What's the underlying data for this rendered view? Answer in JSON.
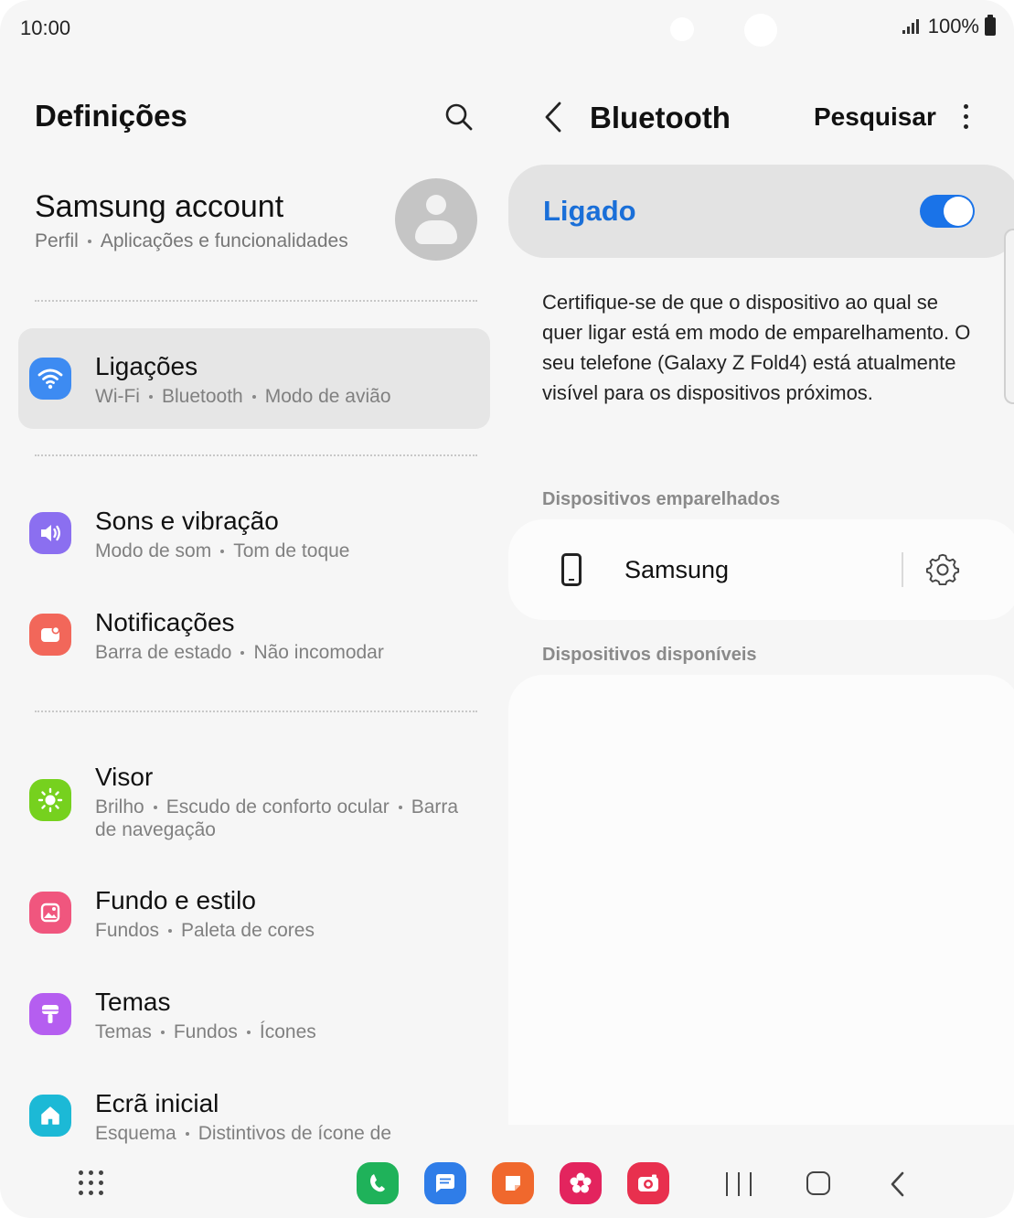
{
  "status_bar": {
    "time": "10:00",
    "battery": "100%"
  },
  "left_pane": {
    "title": "Definições",
    "account": {
      "name": "Samsung account",
      "sub": [
        "Perfil",
        "Aplicações e funcionalidades"
      ]
    },
    "items": [
      {
        "title": "Ligações",
        "sub": [
          "Wi-Fi",
          "Bluetooth",
          "Modo de avião"
        ],
        "icon": "wifi-icon",
        "color": "#3d8bf2",
        "active": true
      },
      {
        "title": "Sons e vibração",
        "sub": [
          "Modo de som",
          "Tom de toque"
        ],
        "icon": "volume-icon",
        "color": "#8b6ff0"
      },
      {
        "title": "Notificações",
        "sub": [
          "Barra de estado",
          "Não incomodar"
        ],
        "icon": "notification-icon",
        "color": "#f2675a"
      },
      {
        "title": "Visor",
        "sub": [
          "Brilho",
          "Escudo de conforto ocular",
          "Barra"
        ],
        "sub_line2": "de navegação",
        "icon": "sun-icon",
        "color": "#76d11e"
      },
      {
        "title": "Fundo e estilo",
        "sub": [
          "Fundos",
          "Paleta de cores"
        ],
        "icon": "wallpaper-icon",
        "color": "#f0567e"
      },
      {
        "title": "Temas",
        "sub": [
          "Temas",
          "Fundos",
          "Ícones"
        ],
        "icon": "paint-brush-icon",
        "color": "#b55ef0"
      },
      {
        "title": "Ecrã inicial",
        "sub": [
          "Esquema",
          "Distintivos de ícone de"
        ],
        "icon": "home-icon",
        "color": "#1cb9d6"
      }
    ]
  },
  "right_pane": {
    "title": "Bluetooth",
    "search_label": "Pesquisar",
    "toggle": {
      "label": "Ligado",
      "on": true,
      "color": "#1a73e8"
    },
    "info": "Certifique-se de que o dispositivo ao qual se quer ligar está em modo de emparelhamento. O seu telefone (Galaxy Z Fold4) está atualmente visível para os dispositivos próximos.",
    "paired_label": "Dispositivos emparelhados",
    "paired_devices": [
      {
        "name": "Samsung",
        "icon": "phone-icon"
      }
    ],
    "available_label": "Dispositivos disponíveis"
  },
  "dock": {
    "apps": [
      {
        "name": "phone-app-icon",
        "color": "#1fb25a"
      },
      {
        "name": "messages-app-icon",
        "color": "#2f7de8"
      },
      {
        "name": "notes-app-icon",
        "color": "#f0682d"
      },
      {
        "name": "gallery-app-icon",
        "color": "#e3245e"
      },
      {
        "name": "camera-app-icon",
        "color": "#e8304e"
      }
    ]
  }
}
